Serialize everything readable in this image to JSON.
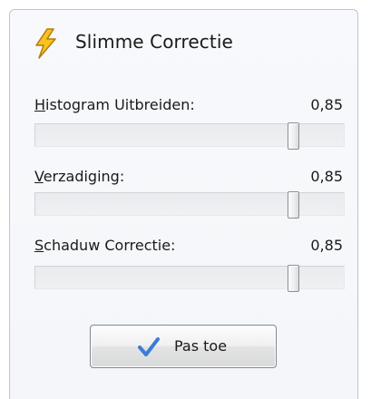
{
  "panel": {
    "title": "Slimme Correctie",
    "title_icon": "lightning-bolt-icon"
  },
  "sliders": [
    {
      "label_accel": "H",
      "label_rest": "istogram Uitbreiden:",
      "value_text": "0,85",
      "value": 0.85
    },
    {
      "label_accel": "V",
      "label_rest": "erzadiging:",
      "value_text": "0,85",
      "value": 0.85
    },
    {
      "label_accel": "S",
      "label_rest": "chaduw Correctie:",
      "value_text": "0,85",
      "value": 0.85
    }
  ],
  "apply_button": {
    "label": "Pas toe",
    "icon": "checkmark-icon"
  },
  "colors": {
    "bolt_fill": "#f7c31d",
    "bolt_stroke": "#b87a0a",
    "check": "#3d7bd6",
    "panel_border": "#b9c6d8"
  }
}
